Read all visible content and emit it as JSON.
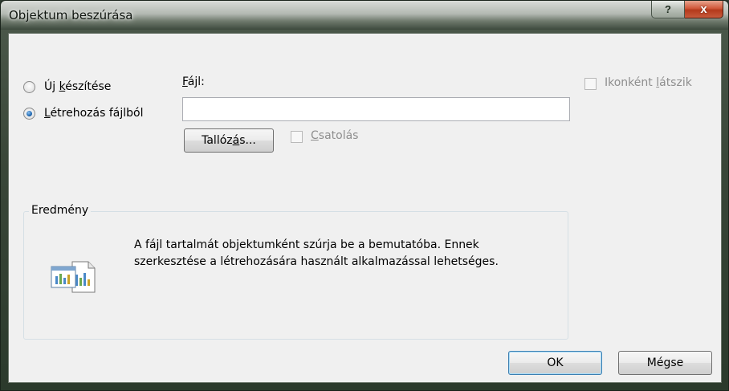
{
  "window": {
    "title": "Objektum beszúrása",
    "help_glyph": "?",
    "close_glyph": "x"
  },
  "options": {
    "new": {
      "label_pre": "Új ",
      "label_key": "k",
      "label_post": "észítése",
      "selected": false
    },
    "from_file": {
      "label_pre": "",
      "label_key": "L",
      "label_post": "étrehozás fájlból",
      "selected": true
    }
  },
  "file": {
    "label_key": "F",
    "label_post": "ájl:",
    "value": "",
    "browse_pre": "Tallóz",
    "browse_key": "á",
    "browse_post": "s..."
  },
  "link": {
    "label_key": "C",
    "label_post": "satolás",
    "checked": false,
    "enabled": false
  },
  "display_as_icon": {
    "label_pre": "Ikonként ",
    "label_key": "l",
    "label_post": "átszik",
    "checked": false,
    "enabled": false
  },
  "result": {
    "title": "Eredmény",
    "line1": "A fájl tartalmát objektumként szúrja be a bemutatóba. Ennek",
    "line2": "szerkesztése a létrehozására használt alkalmazással lehetséges.",
    "icon": "embedded-object-chart-icon"
  },
  "buttons": {
    "ok": "OK",
    "cancel": "Mégse"
  },
  "colors": {
    "accent": "#1f67b0",
    "close": "#c7482b"
  }
}
